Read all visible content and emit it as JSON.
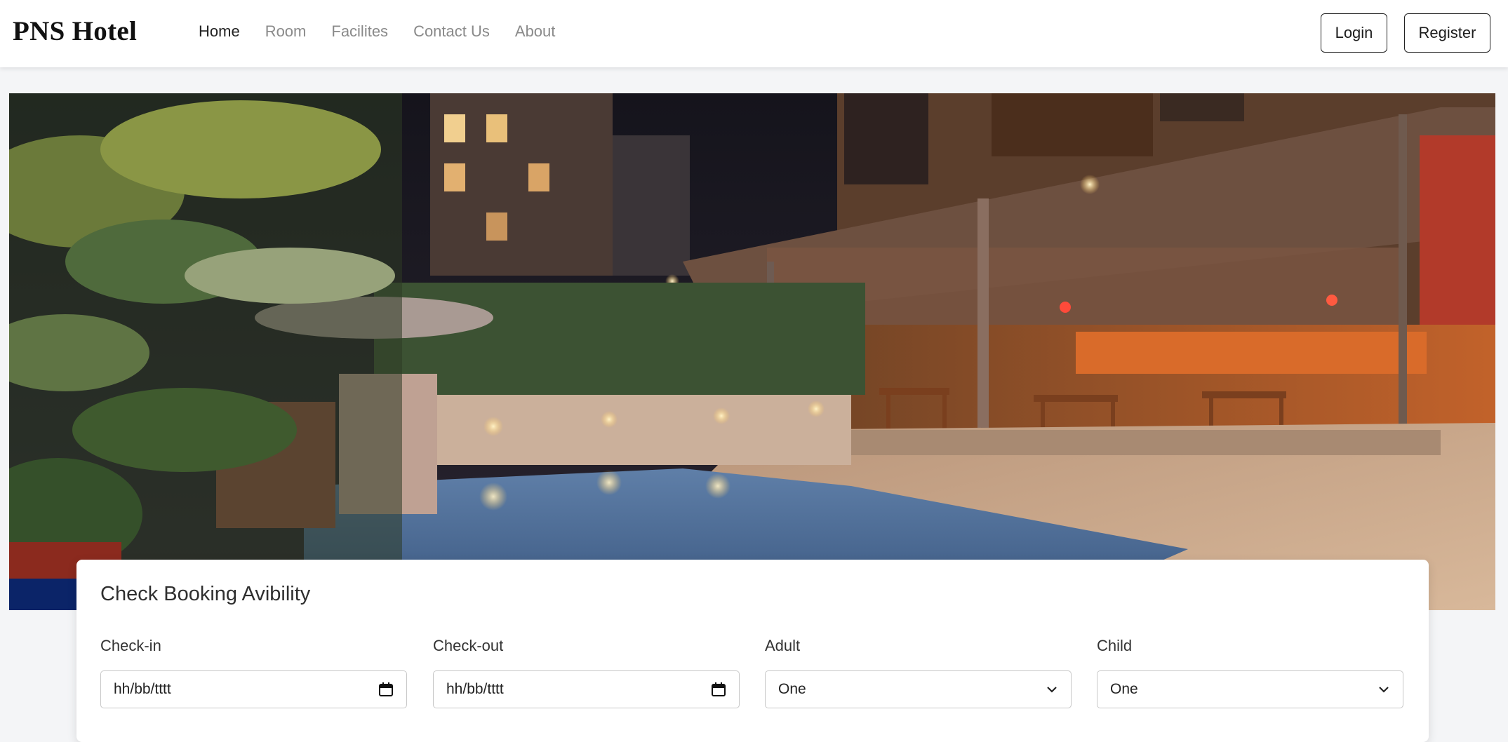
{
  "navbar": {
    "brand": "PNS Hotel",
    "links": [
      "Home",
      "Room",
      "Facilites",
      "Contact Us",
      "About"
    ],
    "login_label": "Login",
    "register_label": "Register"
  },
  "hero": {
    "image_description": "hotel-pool-night-photo"
  },
  "booking": {
    "title": "Check Booking Avibility",
    "checkin_label": "Check-in",
    "checkin_value": "hh/bb/tttt",
    "checkout_label": "Check-out",
    "checkout_value": "hh/bb/tttt",
    "adult_label": "Adult",
    "adult_value": "One",
    "child_label": "Child",
    "child_value": "One"
  },
  "colors": {
    "background": "#f4f5f7",
    "navbar": "#ffffff",
    "active_link": "#212121",
    "inactive_link": "#8a8a8a",
    "hero_blue_strip": "#0b2468"
  }
}
